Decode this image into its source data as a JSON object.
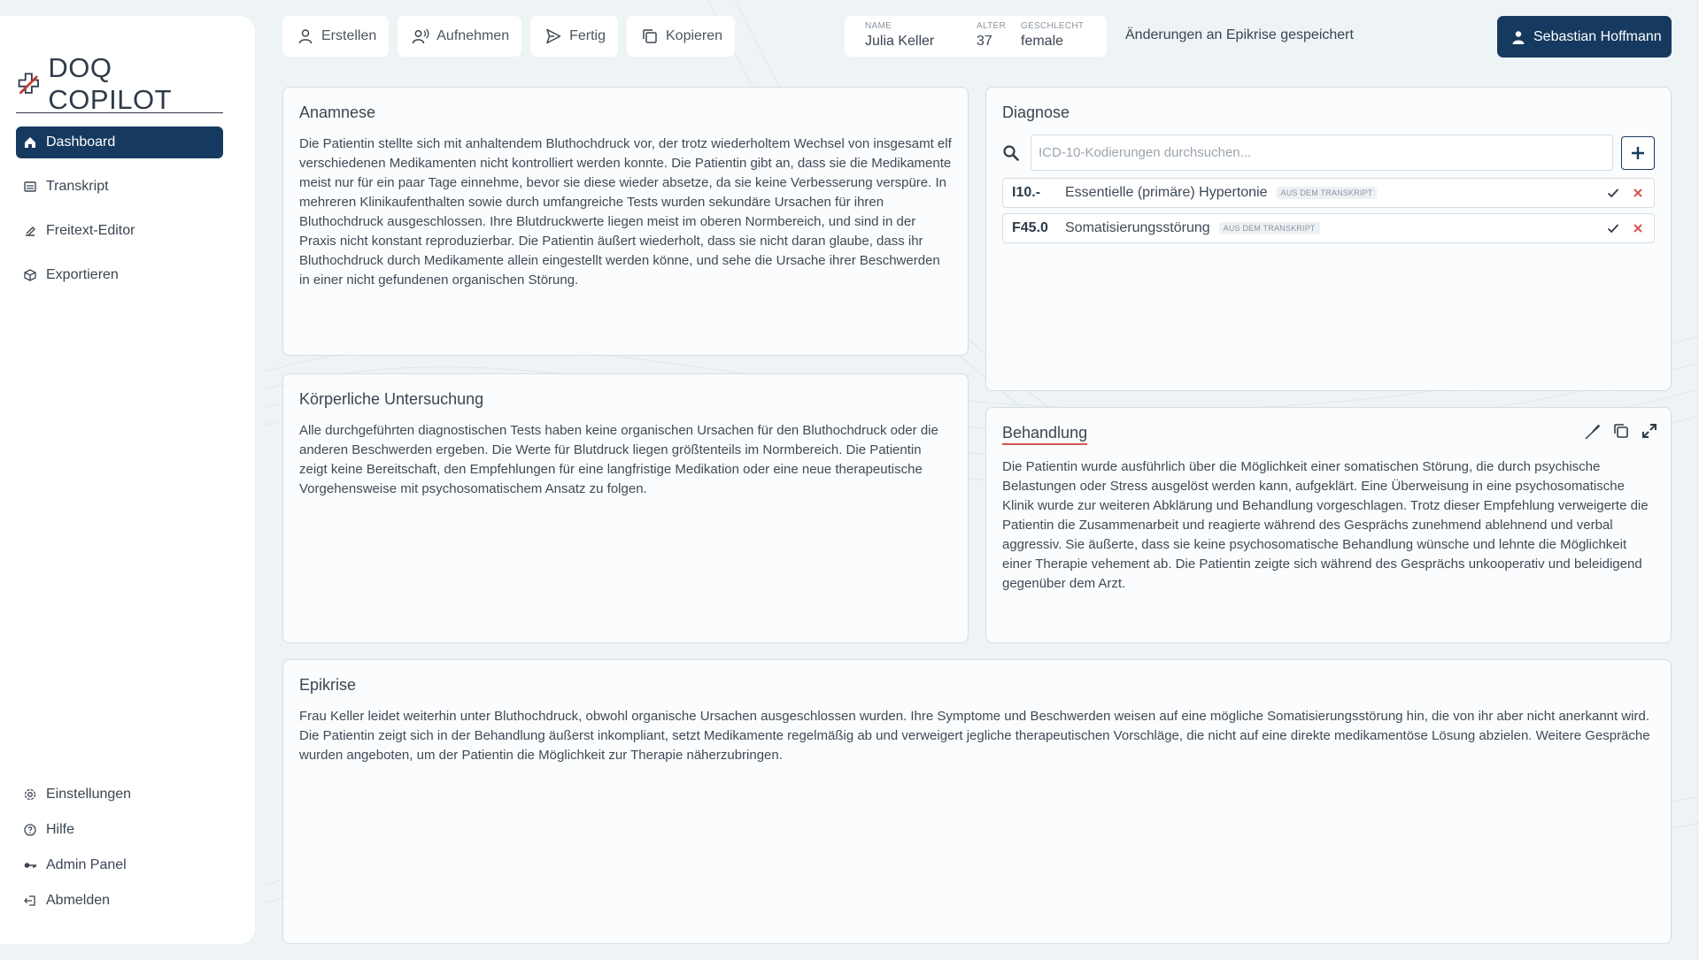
{
  "app": {
    "logo_text": "DOQ COPILOT"
  },
  "sidebar": {
    "items": [
      {
        "label": "Dashboard",
        "icon": "home-icon",
        "active": true
      },
      {
        "label": "Transkript",
        "icon": "transcript-icon"
      },
      {
        "label": "Freitext-Editor",
        "icon": "editor-icon"
      },
      {
        "label": "Exportieren",
        "icon": "export-icon"
      }
    ],
    "bottom_items": [
      {
        "label": "Einstellungen",
        "icon": "gear-icon"
      },
      {
        "label": "Hilfe",
        "icon": "help-icon"
      },
      {
        "label": "Admin Panel",
        "icon": "key-icon"
      },
      {
        "label": "Abmelden",
        "icon": "logout-icon"
      }
    ]
  },
  "toolbar": {
    "create_label": "Erstellen",
    "record_label": "Aufnehmen",
    "done_label": "Fertig",
    "copy_label": "Kopieren"
  },
  "patient": {
    "name_label": "NAME",
    "name": "Julia Keller",
    "age_label": "ALTER",
    "age": "37",
    "gender_label": "GESCHLECHT",
    "gender": "female"
  },
  "status": {
    "message": "Änderungen an Epikrise gespeichert"
  },
  "user": {
    "name": "Sebastian Hoffmann"
  },
  "anamnese": {
    "title": "Anamnese",
    "text": "Die Patientin stellte sich mit anhaltendem Bluthochdruck vor, der trotz wiederholtem Wechsel von insgesamt elf verschiedenen Medikamenten nicht kontrolliert werden konnte. Die Patientin gibt an, dass sie die Medikamente meist nur für ein paar Tage einnehme, bevor sie diese wieder absetze, da sie keine Verbesserung verspüre. In mehreren Klinikaufenthalten sowie durch umfangreiche Tests wurden sekundäre Ursachen für ihren Bluthochdruck ausgeschlossen. Ihre Blutdruckwerte liegen meist im oberen Normbereich, und sind in der Praxis nicht konstant reproduzierbar. Die Patientin äußert wiederholt, dass sie nicht daran glaube, dass ihr Bluthochdruck durch Medikamente allein eingestellt werden könne, und sehe die Ursache ihrer Beschwerden in einer nicht gefundenen organischen Störung."
  },
  "koerper": {
    "title": "Körperliche Untersuchung",
    "text": "Alle durchgeführten diagnostischen Tests haben keine organischen Ursachen für den Bluthochdruck oder die anderen Beschwerden ergeben. Die Werte für Blutdruck liegen größtenteils im Normbereich. Die Patientin zeigt keine Bereitschaft, den Empfehlungen für eine langfristige Medikation oder eine neue therapeutische Vorgehensweise mit psychosomatischem Ansatz zu folgen."
  },
  "diagnose": {
    "title": "Diagnose",
    "search_placeholder": "ICD-10-Kodierungen durchsuchen...",
    "items": [
      {
        "code": "I10.-",
        "name": "Essentielle (primäre) Hypertonie",
        "badge": "AUS DEM TRANSKRIPT"
      },
      {
        "code": "F45.0",
        "name": "Somatisierungsstörung",
        "badge": "AUS DEM TRANSKRIPT"
      }
    ]
  },
  "behandlung": {
    "title": "Behandlung",
    "text": "Die Patientin wurde ausführlich über die Möglichkeit einer somatischen Störung, die durch psychische Belastungen oder Stress ausgelöst werden kann, aufgeklärt. Eine Überweisung in eine psychosomatische Klinik wurde zur weiteren Abklärung und Behandlung vorgeschlagen. Trotz dieser Empfehlung verweigerte die Patientin die Zusammenarbeit und reagierte während des Gesprächs zunehmend ablehnend und verbal aggressiv. Sie äußerte, dass sie keine psychosomatische Behandlung wünsche und lehnte die Möglichkeit einer Therapie vehement ab. Die Patientin zeigte sich während des Gesprächs unkooperativ und beleidigend gegenüber dem Arzt."
  },
  "epikrise": {
    "title": "Epikrise",
    "text": "Frau Keller leidet weiterhin unter Bluthochdruck, obwohl organische Ursachen ausgeschlossen wurden. Ihre Symptome und Beschwerden weisen auf eine mögliche Somatisierungsstörung hin, die von ihr aber nicht anerkannt wird. Die Patientin zeigt sich in der Behandlung äußerst inkompliant, setzt Medikamente regelmäßig ab und verweigert jegliche therapeutischen Vorschläge, die nicht auf eine direkte medikamentöse Lösung abzielen. Weitere Gespräche wurden angeboten, um der Patientin die Möglichkeit zur Therapie näherzubringen."
  },
  "colors": {
    "primary": "#163a5f",
    "danger": "#d9534f",
    "background": "#eef3f6",
    "logo_accent": "#c0392b"
  }
}
